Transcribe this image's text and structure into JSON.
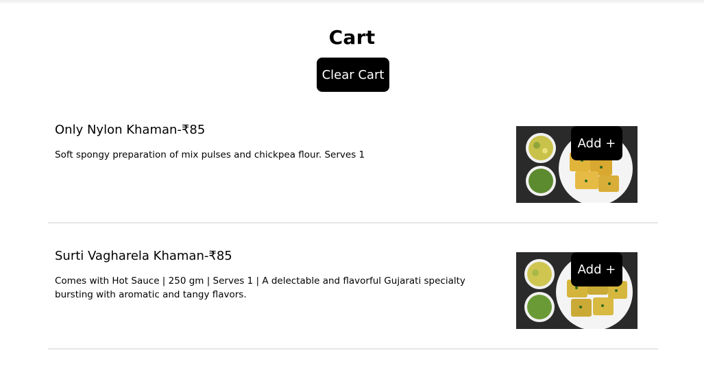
{
  "cart": {
    "title": "Cart",
    "clear_label": "Clear Cart"
  },
  "items": [
    {
      "name": "Only Nylon Khaman-₹85",
      "description": "Soft spongy preparation of mix pulses and chickpea flour. Serves 1",
      "add_label": "Add +",
      "image": "khaman-dish-image"
    },
    {
      "name": "Surti Vagharela Khaman-₹85",
      "description": "Comes with Hot Sauce | 250 gm | Serves 1 | A delectable and flavorful Gujarati specialty bursting with aromatic and tangy flavors.",
      "add_label": "Add +",
      "image": "vagharela-khaman-dish-image"
    }
  ],
  "colors": {
    "button_bg": "#000000",
    "button_text": "#ffffff",
    "divider": "#e6e6e6"
  }
}
